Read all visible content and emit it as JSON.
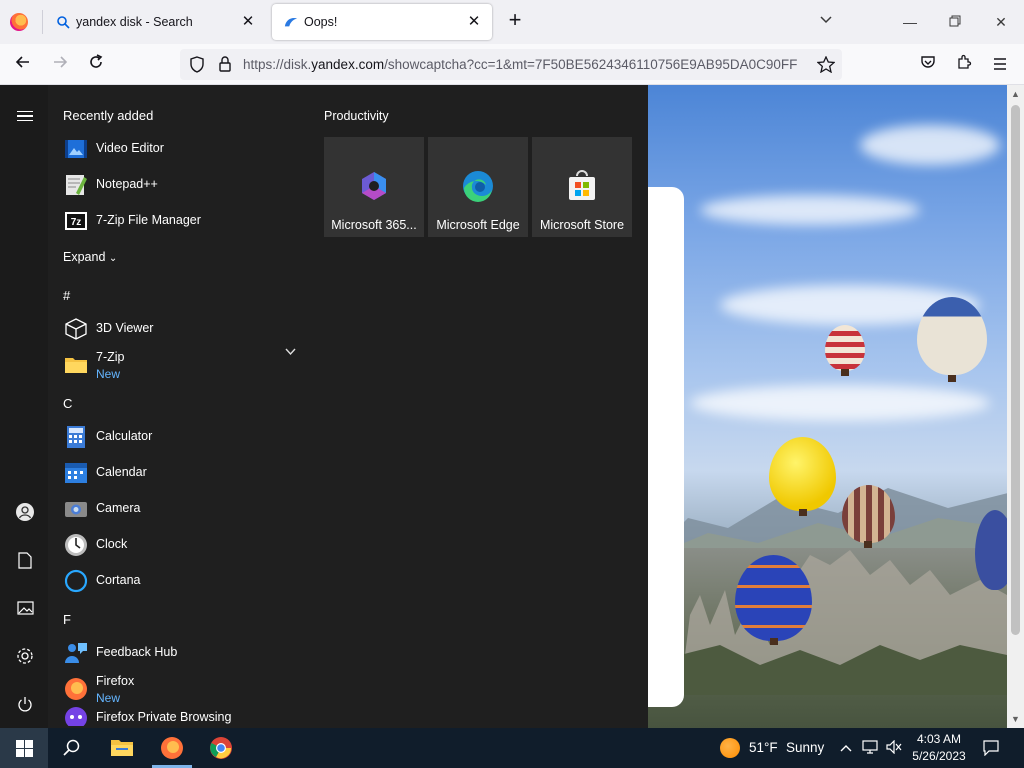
{
  "browser": {
    "tabs": [
      {
        "title": "yandex disk - Search",
        "active": false
      },
      {
        "title": "Oops!",
        "active": true
      }
    ],
    "url": {
      "prefix": "https://disk.",
      "domain": "yandex.com",
      "path": "/showcaptcha?cc=1&mt=7F50BE5624346110756E9AB95DA0C90FF"
    },
    "accent_color": "#ff7139"
  },
  "start_menu": {
    "recently_added_label": "Recently added",
    "recent_apps": [
      {
        "name": "Video Editor",
        "icon": "video-editor-icon"
      },
      {
        "name": "Notepad++",
        "icon": "notepad-plus-plus-icon"
      },
      {
        "name": "7-Zip File Manager",
        "icon": "seven-zip-icon"
      }
    ],
    "expand_label": "Expand",
    "groups": [
      {
        "letter": "#",
        "apps": [
          {
            "name": "3D Viewer",
            "icon": "cube-icon"
          },
          {
            "name": "7-Zip",
            "sub": "New",
            "icon": "folder-icon"
          }
        ]
      },
      {
        "letter": "C",
        "apps": [
          {
            "name": "Calculator",
            "icon": "calculator-icon"
          },
          {
            "name": "Calendar",
            "icon": "calendar-icon"
          },
          {
            "name": "Camera",
            "icon": "camera-icon"
          },
          {
            "name": "Clock",
            "icon": "clock-icon"
          },
          {
            "name": "Cortana",
            "icon": "cortana-icon"
          }
        ]
      },
      {
        "letter": "F",
        "apps": [
          {
            "name": "Feedback Hub",
            "icon": "feedback-hub-icon"
          },
          {
            "name": "Firefox",
            "sub": "New",
            "icon": "firefox-icon"
          },
          {
            "name": "Firefox Private Browsing",
            "icon": "firefox-private-icon"
          }
        ]
      }
    ],
    "tiles_header": "Productivity",
    "tiles": [
      {
        "label": "Microsoft 365...",
        "icon": "microsoft-365-icon"
      },
      {
        "label": "Microsoft Edge",
        "icon": "edge-icon"
      },
      {
        "label": "Microsoft Store",
        "icon": "store-icon"
      }
    ]
  },
  "taskbar": {
    "weather": {
      "temp": "51°F",
      "condition": "Sunny"
    },
    "clock": {
      "time": "4:03 AM",
      "date": "5/26/2023"
    }
  }
}
